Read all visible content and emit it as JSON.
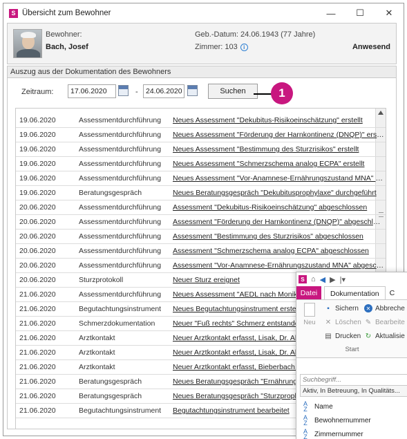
{
  "window": {
    "title": "Übersicht zum Bewohner",
    "app_icon": "S",
    "controls": {
      "minimize": "—",
      "maximize": "☐",
      "close": "✕"
    }
  },
  "resident": {
    "label": "Bewohner:",
    "name": "Bach, Josef",
    "dob": "Geb.-Datum: 24.06.1943 (77 Jahre)",
    "room": "Zimmer: 103",
    "status": "Anwesend"
  },
  "excerpt": {
    "heading": "Auszug aus der Dokumentation des Bewohners",
    "period_label": "Zeitraum:",
    "date_from": "17.06.2020",
    "separator": "-",
    "date_to": "24.06.2020",
    "search_button": "Suchen",
    "callout": "1"
  },
  "entries": [
    {
      "date": "19.06.2020",
      "type": "Assessmentdurchführung",
      "desc": "Neues Assessment \"Dekubitus-Risikoeinschätzung\" erstellt"
    },
    {
      "date": "19.06.2020",
      "type": "Assessmentdurchführung",
      "desc": "Neues Assessment \"Förderung der Harnkontinenz (DNQP)\" erstellt"
    },
    {
      "date": "19.06.2020",
      "type": "Assessmentdurchführung",
      "desc": "Neues Assessment \"Bestimmung des Sturzrisikos\" erstellt"
    },
    {
      "date": "19.06.2020",
      "type": "Assessmentdurchführung",
      "desc": "Neues Assessment \"Schmerzschema analog ECPA\" erstellt"
    },
    {
      "date": "19.06.2020",
      "type": "Assessmentdurchführung",
      "desc": "Neues Assessment \"Vor-Anamnese-Ernährungszustand MNA\" erst..."
    },
    {
      "date": "19.06.2020",
      "type": "Beratungsgespräch",
      "desc": "Neues Beratungsgespräch \"Dekubitusprophylaxe\" durchgeführt"
    },
    {
      "date": "20.06.2020",
      "type": "Assessmentdurchführung",
      "desc": "Assessment \"Dekubitus-Risikoeinschätzung\" abgeschlossen"
    },
    {
      "date": "20.06.2020",
      "type": "Assessmentdurchführung",
      "desc": "Assessment \"Förderung der Harnkontinenz (DNQP)\" abgeschlossen"
    },
    {
      "date": "20.06.2020",
      "type": "Assessmentdurchführung",
      "desc": "Assessment \"Bestimmung des Sturzrisikos\" abgeschlossen"
    },
    {
      "date": "20.06.2020",
      "type": "Assessmentdurchführung",
      "desc": "Assessment \"Schmerzschema analog ECPA\" abgeschlossen"
    },
    {
      "date": "20.06.2020",
      "type": "Assessmentdurchführung",
      "desc": "Assessment \"Vor-Anamnese-Ernährungszustand MNA\" abgeschlo..."
    },
    {
      "date": "20.06.2020",
      "type": "Sturzprotokoll",
      "desc": "Neuer Sturz ereignet"
    },
    {
      "date": "21.06.2020",
      "type": "Assessmentdurchführung",
      "desc": "Neues Assessment \"AEDL nach Monika"
    },
    {
      "date": "21.06.2020",
      "type": "Begutachtungsinstrument",
      "desc": "Neues Begutachtungsinstrument erste"
    },
    {
      "date": "21.06.2020",
      "type": "Schmerzdokumentation",
      "desc": "Neuer \"Fuß rechts\" Schmerz entstande"
    },
    {
      "date": "21.06.2020",
      "type": "Arztkontakt",
      "desc": "Neuer Arztkontakt erfasst, Lisak, Dr. Al"
    },
    {
      "date": "21.06.2020",
      "type": "Arztkontakt",
      "desc": "Neuer Arztkontakt erfasst, Lisak, Dr. Al"
    },
    {
      "date": "21.06.2020",
      "type": "Arztkontakt",
      "desc": "Neuer Arztkontakt erfasst, Bieberbach,"
    },
    {
      "date": "21.06.2020",
      "type": "Beratungsgespräch",
      "desc": "Neues Beratungsgespräch \"Ernährung"
    },
    {
      "date": "21.06.2020",
      "type": "Beratungsgespräch",
      "desc": "Neues Beratungsgespräch \"Sturzproph"
    },
    {
      "date": "21.06.2020",
      "type": "Begutachtungsinstrument",
      "desc": "Begutachtungsinstrument bearbeitet"
    }
  ],
  "popup": {
    "app_icon": "S",
    "tab_file": "Datei",
    "tab_doc": "Dokumentation",
    "tab_more": "C",
    "new_label": "Neu",
    "save": "Sichern",
    "cancel": "Abbreche",
    "delete": "Löschen",
    "edit": "Bearbeite",
    "print": "Drucken",
    "refresh": "Aktualisie",
    "group_label": "Start",
    "search_placeholder": "Suchbegriff...",
    "filter_value": "Aktiv, In Betreuung, In Qualitäts...",
    "sort_items": [
      "Name",
      "Bewohnernummer",
      "Zimmernummer"
    ]
  },
  "colors": {
    "accent": "#c8177f",
    "link_blue": "#2d6fbf"
  }
}
